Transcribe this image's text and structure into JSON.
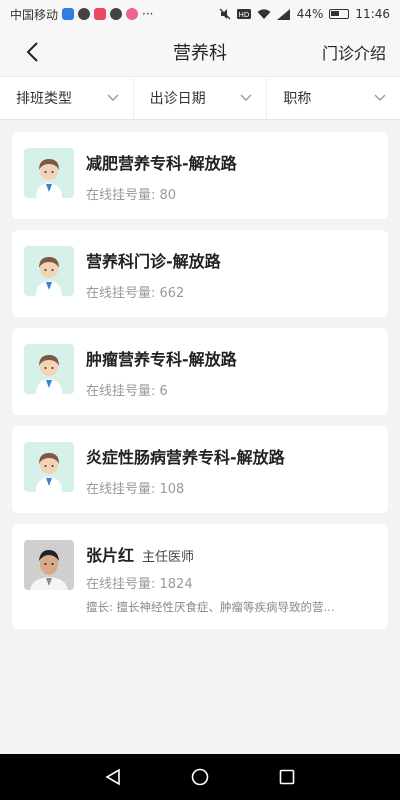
{
  "status_bar": {
    "carrier": "中国移动",
    "battery": "44%",
    "time": "11:46",
    "extra": "···"
  },
  "nav": {
    "title": "营养科",
    "right_label": "门诊介绍"
  },
  "filters": [
    {
      "label": "排班类型"
    },
    {
      "label": "出诊日期"
    },
    {
      "label": "职称"
    }
  ],
  "clinics": [
    {
      "title": "减肥营养专科-解放路",
      "count_label": "在线挂号量: 80"
    },
    {
      "title": "营养科门诊-解放路",
      "count_label": "在线挂号量: 662"
    },
    {
      "title": "肿瘤营养专科-解放路",
      "count_label": "在线挂号量: 6"
    },
    {
      "title": "炎症性肠病营养专科-解放路",
      "count_label": "在线挂号量: 108"
    }
  ],
  "doctor": {
    "name": "张片红",
    "role": "主任医师",
    "count_label": "在线挂号量: 1824",
    "specialty": "擅长: 擅长神经性厌食症、肿瘤等疾病导致的营..."
  },
  "colors": {
    "avatar_bg": "#d6f0ea",
    "background": "#f3f3f3",
    "card": "#ffffff"
  }
}
